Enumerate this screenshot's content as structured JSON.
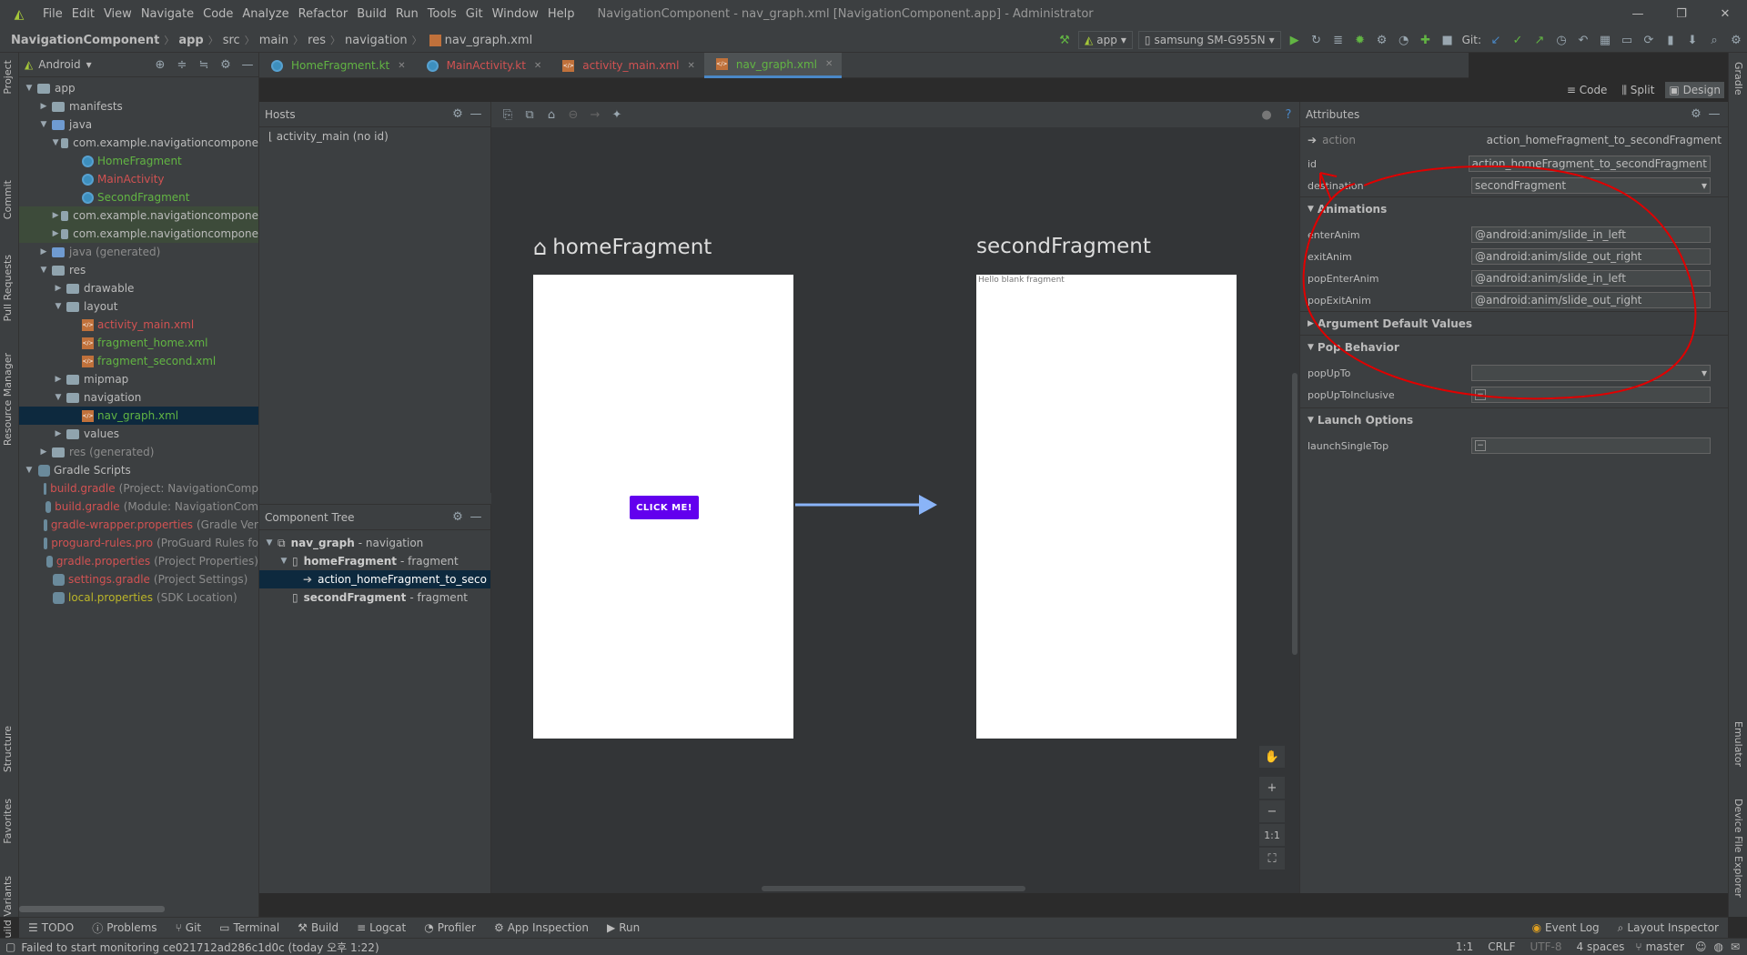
{
  "window": {
    "title": "NavigationComponent - nav_graph.xml [NavigationComponent.app] - Administrator",
    "menu": [
      "File",
      "Edit",
      "View",
      "Navigate",
      "Code",
      "Analyze",
      "Refactor",
      "Build",
      "Run",
      "Tools",
      "Git",
      "Window",
      "Help"
    ]
  },
  "breadcrumbs": [
    "NavigationComponent",
    "app",
    "src",
    "main",
    "res",
    "navigation",
    "nav_graph.xml"
  ],
  "toolbar": {
    "run_config": "app",
    "device": "samsung SM-G955N",
    "git_label": "Git:"
  },
  "project_panel": {
    "view_mode": "Android",
    "tree": [
      {
        "label": "app",
        "color": "default",
        "level": 0,
        "icon": "folder"
      },
      {
        "label": "manifests",
        "color": "default",
        "level": 1,
        "icon": "folder"
      },
      {
        "label": "java",
        "color": "default",
        "level": 1,
        "icon": "folder"
      },
      {
        "label": "com.example.navigationcompone",
        "color": "default",
        "level": 2,
        "icon": "folder"
      },
      {
        "label": "HomeFragment",
        "color": "green",
        "level": 3,
        "icon": "kotlin"
      },
      {
        "label": "MainActivity",
        "color": "red",
        "level": 3,
        "icon": "kotlin"
      },
      {
        "label": "SecondFragment",
        "color": "green",
        "level": 3,
        "icon": "kotlin"
      },
      {
        "label": "com.example.navigationcompone",
        "color": "default",
        "level": 2,
        "icon": "folder",
        "highlight": true
      },
      {
        "label": "com.example.navigationcompone",
        "color": "default",
        "level": 2,
        "icon": "folder",
        "highlight": true
      },
      {
        "label": "java (generated)",
        "color": "default",
        "level": 1,
        "icon": "folder"
      },
      {
        "label": "res",
        "color": "default",
        "level": 1,
        "icon": "folder"
      },
      {
        "label": "drawable",
        "color": "default",
        "level": 2,
        "icon": "folder"
      },
      {
        "label": "layout",
        "color": "default",
        "level": 2,
        "icon": "folder"
      },
      {
        "label": "activity_main.xml",
        "color": "red",
        "level": 3,
        "icon": "xml"
      },
      {
        "label": "fragment_home.xml",
        "color": "green",
        "level": 3,
        "icon": "xml"
      },
      {
        "label": "fragment_second.xml",
        "color": "green",
        "level": 3,
        "icon": "xml"
      },
      {
        "label": "mipmap",
        "color": "default",
        "level": 2,
        "icon": "folder"
      },
      {
        "label": "navigation",
        "color": "default",
        "level": 2,
        "icon": "folder"
      },
      {
        "label": "nav_graph.xml",
        "color": "green",
        "level": 3,
        "icon": "xml",
        "selected": true
      },
      {
        "label": "values",
        "color": "default",
        "level": 2,
        "icon": "folder"
      },
      {
        "label": "res (generated)",
        "color": "default",
        "level": 1,
        "icon": "folder"
      },
      {
        "label": "Gradle Scripts",
        "color": "default",
        "level": 0,
        "icon": "gradle"
      },
      {
        "label": "build.gradle",
        "note": "(Project: NavigationComp",
        "color": "red",
        "level": 1,
        "icon": "gradle"
      },
      {
        "label": "build.gradle",
        "note": "(Module: NavigationCom",
        "color": "red",
        "level": 1,
        "icon": "gradle"
      },
      {
        "label": "gradle-wrapper.properties",
        "note": "(Gradle Ver",
        "color": "red",
        "level": 1,
        "icon": "gradle"
      },
      {
        "label": "proguard-rules.pro",
        "note": "(ProGuard Rules fo",
        "color": "red",
        "level": 1,
        "icon": "gradle"
      },
      {
        "label": "gradle.properties",
        "note": "(Project Properties)",
        "color": "red",
        "level": 1,
        "icon": "gradle"
      },
      {
        "label": "settings.gradle",
        "note": "(Project Settings)",
        "color": "red",
        "level": 1,
        "icon": "gradle"
      },
      {
        "label": "local.properties",
        "note": "(SDK Location)",
        "color": "yellow",
        "level": 1,
        "icon": "gradle"
      }
    ]
  },
  "side_tabs_left": [
    "Project",
    "Commit",
    "Pull Requests",
    "Resource Manager",
    "Structure",
    "Favorites",
    "Build Variants"
  ],
  "side_tabs_right": [
    "Gradle",
    "Emulator",
    "Device File Explorer"
  ],
  "editor_tabs": [
    {
      "label": "HomeFragment.kt",
      "color": "green",
      "icon": "kotlin"
    },
    {
      "label": "MainActivity.kt",
      "color": "red",
      "icon": "kotlin"
    },
    {
      "label": "activity_main.xml",
      "color": "red",
      "icon": "xml"
    },
    {
      "label": "nav_graph.xml",
      "color": "green",
      "icon": "xml",
      "active": true
    }
  ],
  "view_modes": [
    "Code",
    "Split",
    "Design"
  ],
  "hosts": {
    "title": "Hosts",
    "item": "activity_main (no id)"
  },
  "component_tree": {
    "title": "Component Tree",
    "items": [
      {
        "name": "nav_graph",
        "type": "- navigation",
        "level": 0
      },
      {
        "name": "homeFragment",
        "type": "- fragment",
        "level": 1
      },
      {
        "name": "action_homeFragment_to_seco",
        "type": "",
        "level": 2,
        "selected": true
      },
      {
        "name": "secondFragment",
        "type": "- fragment",
        "level": 1
      }
    ]
  },
  "canvas": {
    "home_label": "homeFragment",
    "second_label": "secondFragment",
    "button_text": "CLICK ME!",
    "second_text": "Hello blank fragment",
    "zoom_fit": "1:1"
  },
  "attributes": {
    "title": "Attributes",
    "action_label": "action",
    "action_value": "action_homeFragment_to_secondFragment",
    "id_label": "id",
    "id_value": "action_homeFragment_to_secondFragment",
    "destination_label": "destination",
    "destination_value": "secondFragment",
    "animations_title": "Animations",
    "anims": [
      {
        "k": "enterAnim",
        "v": "@android:anim/slide_in_left"
      },
      {
        "k": "exitAnim",
        "v": "@android:anim/slide_out_right"
      },
      {
        "k": "popEnterAnim",
        "v": "@android:anim/slide_in_left"
      },
      {
        "k": "popExitAnim",
        "v": "@android:anim/slide_out_right"
      }
    ],
    "arg_title": "Argument Default Values",
    "pop_title": "Pop Behavior",
    "popUpTo": "popUpTo",
    "popUpToInclusive": "popUpToInclusive",
    "launch_title": "Launch Options",
    "launchSingleTop": "launchSingleTop"
  },
  "tool_windows": [
    "TODO",
    "Problems",
    "Git",
    "Terminal",
    "Build",
    "Logcat",
    "Profiler",
    "App Inspection",
    "Run"
  ],
  "tool_windows_right": [
    "Event Log",
    "Layout Inspector"
  ],
  "status": {
    "message": "Failed to start monitoring ce021712ad286c1d0c (today 오후 1:22)",
    "position": "1:1",
    "line_sep": "CRLF",
    "encoding": "UTF-8",
    "indent": "4 spaces",
    "branch": "master"
  },
  "colors": {
    "accent": "#4a88c7",
    "annotation": "#e00000",
    "button": "#6200ee",
    "arrow": "#8ab4f8"
  }
}
